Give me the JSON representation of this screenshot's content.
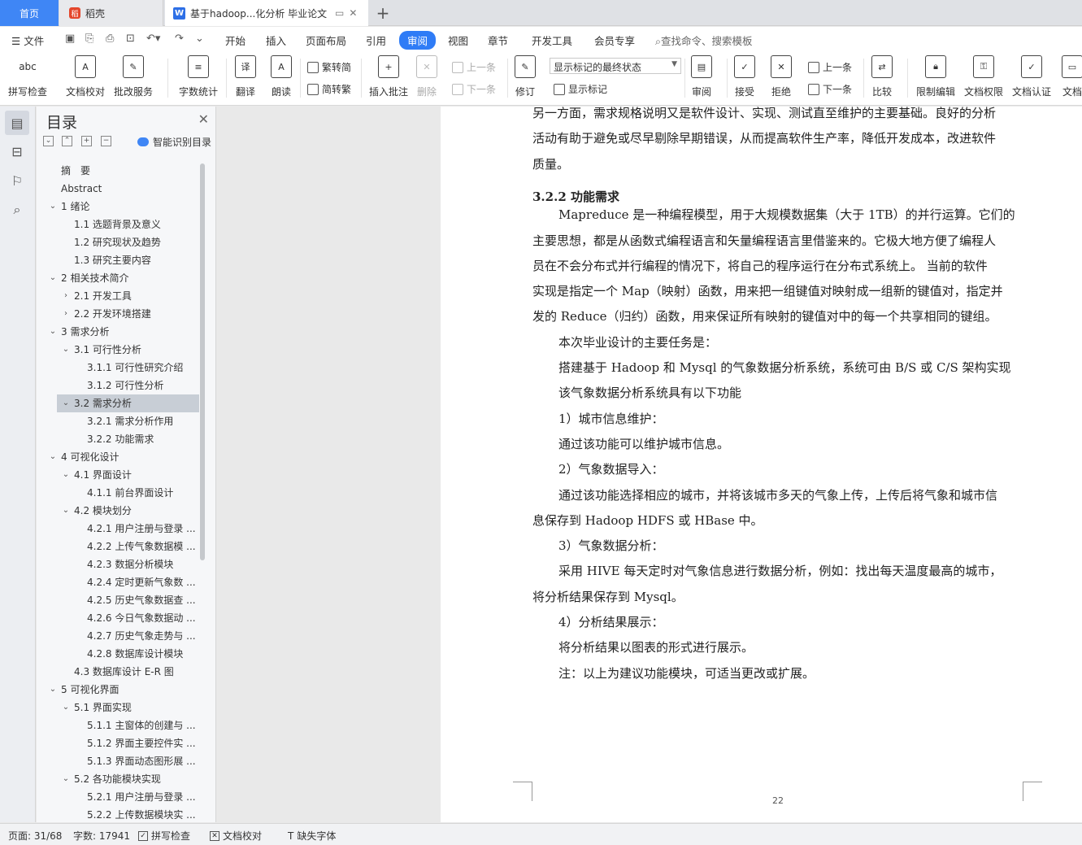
{
  "tabs": {
    "home": "首页",
    "daoke": "稻壳",
    "doc": "基于hadoop...化分析 毕业论文",
    "new_tab": "+"
  },
  "menu": {
    "file": "文件",
    "items": [
      "开始",
      "插入",
      "页面布局",
      "引用",
      "审阅",
      "视图",
      "章节",
      "开发工具",
      "会员专享"
    ],
    "active": "审阅",
    "search_placeholder": "查找命令、搜索模板"
  },
  "ribbon": {
    "spell_check": "拼写检查",
    "doc_proof": "文档校对",
    "batch_service": "批改服务",
    "word_count": "字数统计",
    "translate": "翻译",
    "read_aloud": "朗读",
    "trad": "繁转简",
    "simp": "简转繁",
    "insert_comment": "插入批注",
    "delete": "删除",
    "prev_comment": "上一条",
    "next_comment": "下一条",
    "revise": "修订",
    "show_final": "显示标记的最终状态",
    "show_marks": "显示标记",
    "review": "审阅",
    "accept": "接受",
    "reject": "拒绝",
    "prev_change": "上一条",
    "next_change": "下一条",
    "compare": "比较",
    "restrict_edit": "限制编辑",
    "doc_permission": "文档权限",
    "doc_cert": "文档认证",
    "doc_more": "文档"
  },
  "toc": {
    "title": "目录",
    "smart": "智能识别目录",
    "items": [
      {
        "text": "摘　要",
        "level": 0,
        "arrow": ""
      },
      {
        "text": "Abstract",
        "level": 0,
        "arrow": ""
      },
      {
        "text": "1 绪论",
        "level": 0,
        "arrow": "v"
      },
      {
        "text": "1.1 选题背景及意义",
        "level": 1,
        "arrow": ""
      },
      {
        "text": "1.2 研究现状及趋势",
        "level": 1,
        "arrow": ""
      },
      {
        "text": "1.3 研究主要内容",
        "level": 1,
        "arrow": ""
      },
      {
        "text": "2 相关技术简介",
        "level": 0,
        "arrow": "v"
      },
      {
        "text": "2.1 开发工具",
        "level": 1,
        "arrow": ">"
      },
      {
        "text": "2.2 开发环境搭建",
        "level": 1,
        "arrow": ">"
      },
      {
        "text": "3  需求分析",
        "level": 0,
        "arrow": "v"
      },
      {
        "text": "3.1 可行性分析",
        "level": 1,
        "arrow": "v"
      },
      {
        "text": "3.1.1 可行性研究介绍",
        "level": 2,
        "arrow": ""
      },
      {
        "text": "3.1.2 可行性分析",
        "level": 2,
        "arrow": ""
      },
      {
        "text": "3.2 需求分析",
        "level": 1,
        "arrow": "v",
        "selected": true
      },
      {
        "text": "3.2.1 需求分析作用",
        "level": 2,
        "arrow": ""
      },
      {
        "text": "3.2.2 功能需求",
        "level": 2,
        "arrow": ""
      },
      {
        "text": "4  可视化设计",
        "level": 0,
        "arrow": "v"
      },
      {
        "text": "4.1 界面设计",
        "level": 1,
        "arrow": "v"
      },
      {
        "text": "4.1.1 前台界面设计",
        "level": 2,
        "arrow": ""
      },
      {
        "text": "4.2 模块划分",
        "level": 1,
        "arrow": "v"
      },
      {
        "text": "4.2.1 用户注册与登录 ...",
        "level": 2,
        "arrow": ""
      },
      {
        "text": "4.2.2 上传气象数据模 ...",
        "level": 2,
        "arrow": ""
      },
      {
        "text": "4.2.3 数据分析模块",
        "level": 2,
        "arrow": ""
      },
      {
        "text": "4.2.4 定时更新气象数 ...",
        "level": 2,
        "arrow": ""
      },
      {
        "text": "4.2.5 历史气象数据查 ...",
        "level": 2,
        "arrow": ""
      },
      {
        "text": "4.2.6 今日气象数据动 ...",
        "level": 2,
        "arrow": ""
      },
      {
        "text": "4.2.7 历史气象走势与 ...",
        "level": 2,
        "arrow": ""
      },
      {
        "text": "4.2.8 数据库设计模块",
        "level": 2,
        "arrow": ""
      },
      {
        "text": "4.3 数据库设计 E-R 图",
        "level": 1,
        "arrow": ""
      },
      {
        "text": "5  可视化界面",
        "level": 0,
        "arrow": "v"
      },
      {
        "text": "5.1 界面实现",
        "level": 1,
        "arrow": "v"
      },
      {
        "text": "5.1.1 主窗体的创建与 ...",
        "level": 2,
        "arrow": ""
      },
      {
        "text": "5.1.2  界面主要控件实 ...",
        "level": 2,
        "arrow": ""
      },
      {
        "text": "5.1.3 界面动态图形展 ...",
        "level": 2,
        "arrow": ""
      },
      {
        "text": "5.2 各功能模块实现",
        "level": 1,
        "arrow": "v"
      },
      {
        "text": "5.2.1 用户注册与登录 ...",
        "level": 2,
        "arrow": ""
      },
      {
        "text": "5.2.2 上传数据模块实 ...",
        "level": 2,
        "arrow": ""
      }
    ]
  },
  "document": {
    "lines": [
      {
        "text": "另一方面，需求规格说明又是软件设计、实现、测试直至维护的主要基础。良好的分析",
        "indent": false,
        "heading": false
      },
      {
        "text": "活动有助于避免或尽早剔除早期错误，从而提高软件生产率，降低开发成本，改进软件",
        "indent": false,
        "heading": false
      },
      {
        "text": "质量。",
        "indent": false,
        "heading": false
      },
      {
        "text": "3.2.2 功能需求",
        "indent": false,
        "heading": true
      },
      {
        "text": "Mapreduce 是一种编程模型，用于大规模数据集（大于 1TB）的并行运算。它们的",
        "indent": true,
        "heading": false
      },
      {
        "text": "主要思想，都是从函数式编程语言和矢量编程语言里借鉴来的。它极大地方便了编程人",
        "indent": false,
        "heading": false
      },
      {
        "text": "员在不会分布式并行编程的情况下，将自己的程序运行在分布式系统上。 当前的软件",
        "indent": false,
        "heading": false
      },
      {
        "text": "实现是指定一个 Map（映射）函数，用来把一组键值对映射成一组新的键值对，指定并",
        "indent": false,
        "heading": false
      },
      {
        "text": "发的 Reduce（归约）函数，用来保证所有映射的键值对中的每一个共享相同的键组。",
        "indent": false,
        "heading": false
      },
      {
        "text": "本次毕业设计的主要任务是：",
        "indent": true,
        "heading": false
      },
      {
        "text": "搭建基于 Hadoop 和 Mysql 的气象数据分析系统，系统可由 B/S 或 C/S 架构实现",
        "indent": true,
        "heading": false
      },
      {
        "text": "该气象数据分析系统具有以下功能",
        "indent": true,
        "heading": false
      },
      {
        "text": "1）城市信息维护：",
        "indent": true,
        "heading": false
      },
      {
        "text": "通过该功能可以维护城市信息。",
        "indent": true,
        "heading": false
      },
      {
        "text": "2）气象数据导入：",
        "indent": true,
        "heading": false
      },
      {
        "text": "通过该功能选择相应的城市，并将该城市多天的气象上传，上传后将气象和城市信",
        "indent": true,
        "heading": false
      },
      {
        "text": "息保存到 Hadoop HDFS 或 HBase 中。",
        "indent": false,
        "heading": false
      },
      {
        "text": "3）气象数据分析：",
        "indent": true,
        "heading": false
      },
      {
        "text": "采用 HIVE 每天定时对气象信息进行数据分析，例如：找出每天温度最高的城市，",
        "indent": true,
        "heading": false
      },
      {
        "text": "将分析结果保存到 Mysql。",
        "indent": false,
        "heading": false
      },
      {
        "text": "4）分析结果展示：",
        "indent": true,
        "heading": false
      },
      {
        "text": "将分析结果以图表的形式进行展示。",
        "indent": true,
        "heading": false
      },
      {
        "text": "注：以上为建议功能模块，可适当更改或扩展。",
        "indent": true,
        "heading": false
      }
    ],
    "page_number": "22"
  },
  "status": {
    "page": "页面: 31/68",
    "words": "字数: 17941",
    "spell": "拼写检查",
    "proof": "文档校对",
    "missing_font": "缺失字体"
  },
  "colors": {
    "accent": "#2f7cf6",
    "home_tab": "#3f86f5"
  }
}
